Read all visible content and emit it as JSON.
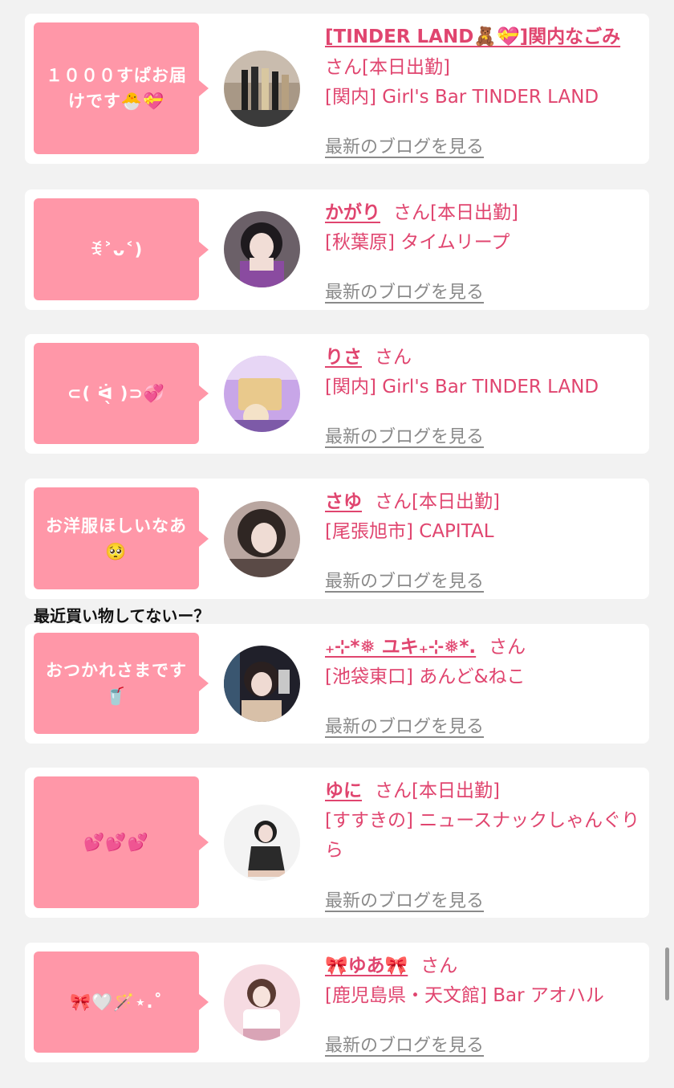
{
  "cards": [
    {
      "message": "１０００すぱお届けです🐣💝",
      "name": "[TINDER LAND🧸💝]関内なごみ",
      "san": "さん",
      "status": "[本日出勤]",
      "shop": "[関内] Girl's Bar TINDER LAND",
      "blog_link": "最新のブログを見る",
      "avatar_colors": [
        "#a89886",
        "#3b3b3b"
      ]
    },
    {
      "message": "ꉂ˃ᴗ˂)",
      "name": "かがり",
      "san": "さん",
      "status": "[本日出勤]",
      "shop": "[秋葉原] タイムリープ",
      "blog_link": "最新のブログを見る",
      "avatar_colors": [
        "#3a2f3a",
        "#8a4ba0"
      ]
    },
    {
      "message": "⊂( ᐛ̖ )⊃💞",
      "name": "りさ",
      "san": "さん",
      "status": "",
      "shop": "[関内] Girl's Bar TINDER LAND",
      "blog_link": "最新のブログを見る",
      "avatar_colors": [
        "#c8a6e8",
        "#7d5aa8"
      ]
    },
    {
      "message": "お洋服ほしいなあ🥺",
      "name": "さゆ",
      "san": "さん",
      "status": "[本日出勤]",
      "shop": "[尾張旭市] CAPITAL",
      "blog_link": "最新のブログを見る",
      "avatar_colors": [
        "#d8c4bc",
        "#2f2623"
      ]
    },
    {
      "message": "おつかれさまです🥤",
      "name": "₊⊹*❅ ユキ₊⊹❅*.",
      "san": "さん",
      "status": "",
      "shop": "[池袋東口] あんど&ねこ",
      "blog_link": "最新のブログを見る",
      "avatar_colors": [
        "#5e4a44",
        "#20202a"
      ]
    },
    {
      "message": "💕💕💕",
      "name": "ゆに",
      "san": "さん",
      "status": "[本日出勤]",
      "shop": "[すすきの] ニュースナックしゃんぐりら",
      "blog_link": "最新のブログを見る",
      "avatar_colors": [
        "#eeeeee",
        "#2a2a2a"
      ]
    },
    {
      "message": "🎀🤍🪄⋆.˚",
      "name": "🎀ゆあ🎀",
      "san": "さん",
      "status": "",
      "shop": "[鹿児島県・天文館] Bar アオハル",
      "blog_link": "最新のブログを見る",
      "avatar_colors": [
        "#f6dbe2",
        "#d9a4b6"
      ]
    }
  ],
  "floating_note": "最近買い物してないー？"
}
